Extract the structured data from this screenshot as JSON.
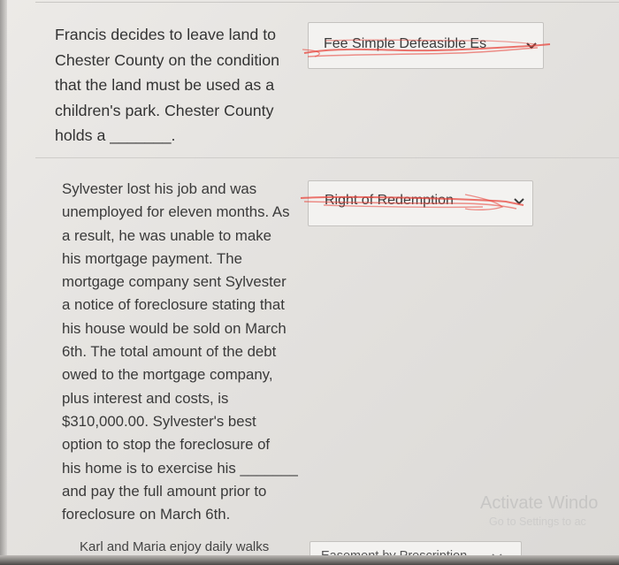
{
  "questions": [
    {
      "text": "Francis decides to leave land to\nChester County on the condition\nthat the land must be used as a\nchildren's park. Chester County\nholds a _______.",
      "selected_answer": "Fee Simple Defeasible Es"
    },
    {
      "text": "Sylvester lost his job and was\nunemployed for eleven months. As\na result, he was unable to make\nhis mortgage payment. The\nmortgage company sent Sylvester\na notice of foreclosure stating that\nhis house would be sold on March\n6th. The total amount of the debt\nowed to the mortgage company,\nplus interest and costs, is\n$310,000.00. Sylvester's best\noption to stop the foreclosure of\nhis home is to exercise his _______\nand pay the full amount prior to\nforeclosure on March 6th.",
      "selected_answer": "Right of Redemption"
    },
    {
      "text": "Karl and Maria enjoy daily walks",
      "selected_answer": "Easement by Prescription"
    }
  ],
  "watermark": {
    "title": "Activate Windo",
    "subtitle": "Go to Settings to ac"
  },
  "colors": {
    "scribble": "#e8473f",
    "text": "#333333",
    "dropdown_bg": "#f3f2f0"
  }
}
